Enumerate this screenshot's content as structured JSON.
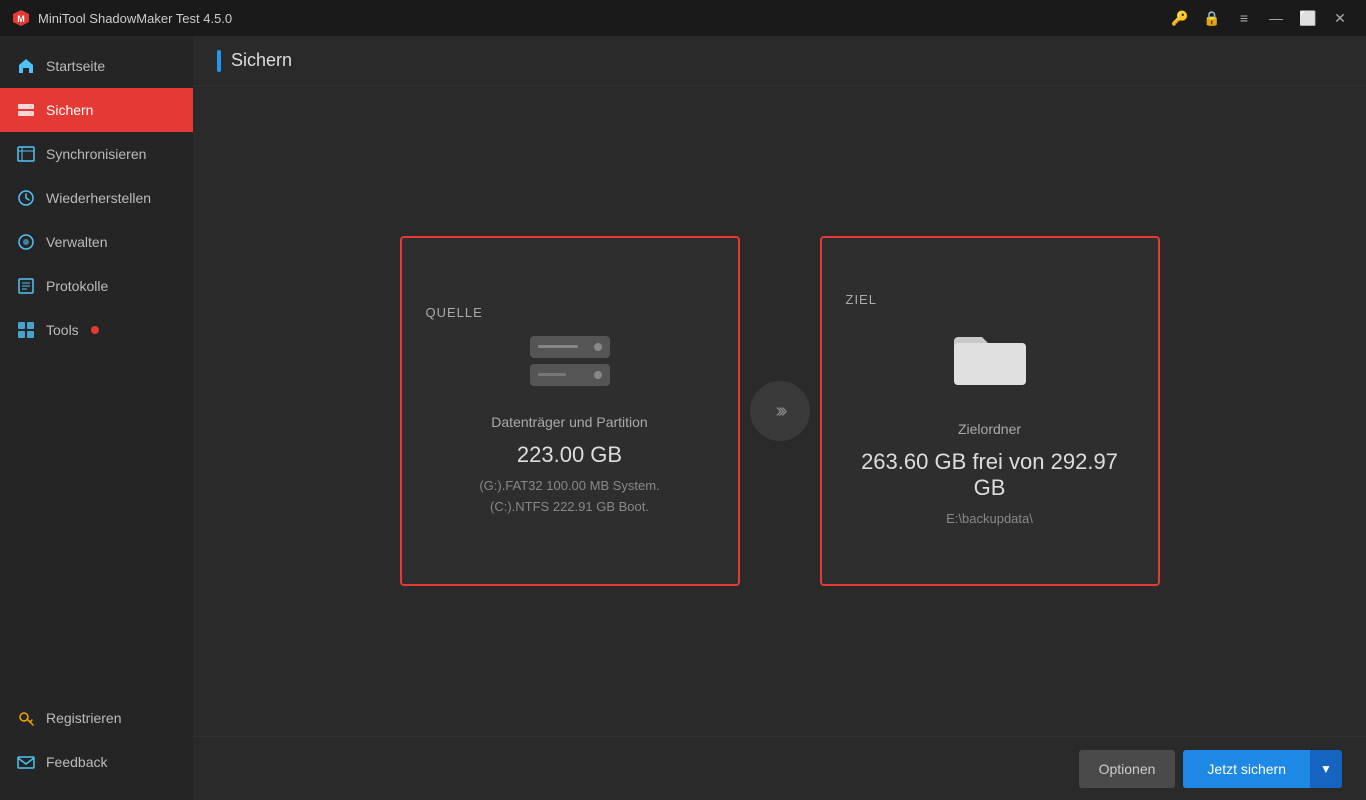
{
  "titlebar": {
    "app_name": "MiniTool ShadowMaker Test 4.5.0",
    "controls": {
      "license_icon": "🔑",
      "lock_icon": "🔒",
      "menu_icon": "≡",
      "minimize": "—",
      "restore": "⬜",
      "close": "✕"
    }
  },
  "sidebar": {
    "items": [
      {
        "id": "startseite",
        "label": "Startseite",
        "icon": "home",
        "active": false
      },
      {
        "id": "sichern",
        "label": "Sichern",
        "icon": "backup",
        "active": true
      },
      {
        "id": "synchronisieren",
        "label": "Synchronisieren",
        "icon": "sync",
        "active": false
      },
      {
        "id": "wiederherstellen",
        "label": "Wiederherstellen",
        "icon": "restore",
        "active": false
      },
      {
        "id": "verwalten",
        "label": "Verwalten",
        "icon": "manage",
        "active": false
      },
      {
        "id": "protokolle",
        "label": "Protokolle",
        "icon": "log",
        "active": false
      },
      {
        "id": "tools",
        "label": "Tools",
        "icon": "tools",
        "active": false,
        "badge": true
      }
    ],
    "bottom_items": [
      {
        "id": "registrieren",
        "label": "Registrieren",
        "icon": "key"
      },
      {
        "id": "feedback",
        "label": "Feedback",
        "icon": "mail"
      }
    ]
  },
  "page": {
    "title": "Sichern"
  },
  "source_card": {
    "label": "QUELLE",
    "desc": "Datenträger und Partition",
    "size": "223.00 GB",
    "detail_line1": "(G:).FAT32 100.00 MB System.",
    "detail_line2": "(C:).NTFS 222.91 GB Boot."
  },
  "dest_card": {
    "label": "ZIEL",
    "desc": "Zielordner",
    "free_space": "263.60 GB frei von 292.97 GB",
    "path": "E:\\backupdata\\"
  },
  "toolbar": {
    "options_label": "Optionen",
    "backup_label": "Jetzt sichern"
  }
}
